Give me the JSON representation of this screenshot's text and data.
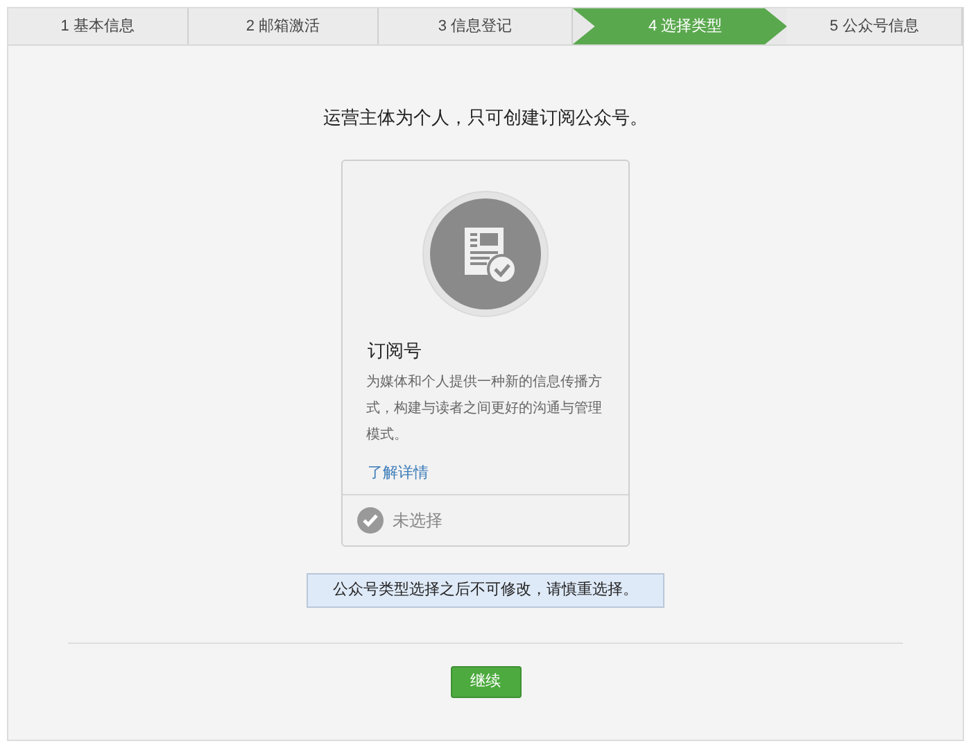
{
  "steps": [
    {
      "label": "1 基本信息",
      "selected": false
    },
    {
      "label": "2 邮箱激活",
      "selected": false
    },
    {
      "label": "3 信息登记",
      "selected": false
    },
    {
      "label": "4 选择类型",
      "selected": true
    },
    {
      "label": "5 公众号信息",
      "selected": false
    }
  ],
  "heading": "运营主体为个人，只可创建订阅公众号。",
  "card": {
    "title": "订阅号",
    "description": "为媒体和个人提供一种新的信息传播方式，构建与读者之间更好的沟通与管理模式。",
    "link": "了解详情",
    "checked": false,
    "status": "未选择"
  },
  "notice": "公众号类型选择之后不可修改，请慎重选择。",
  "continue_button": "继续"
}
